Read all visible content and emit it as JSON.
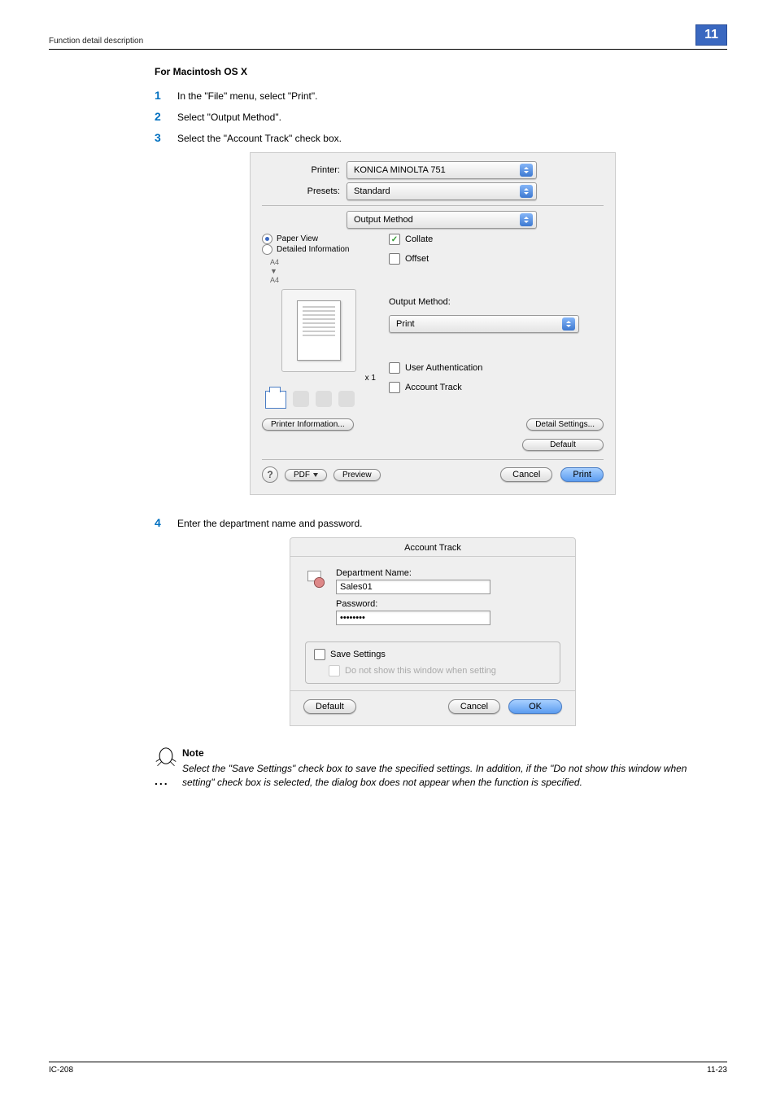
{
  "header": {
    "section_title": "Function detail description",
    "chapter_number": "11"
  },
  "heading": "For Macintosh OS X",
  "steps": {
    "s1": {
      "num": "1",
      "text": "In the \"File\" menu, select \"Print\"."
    },
    "s2": {
      "num": "2",
      "text": "Select \"Output Method\"."
    },
    "s3": {
      "num": "3",
      "text": "Select the \"Account Track\" check box."
    },
    "s4": {
      "num": "4",
      "text": "Enter the department name and password."
    }
  },
  "print_dialog": {
    "printer_label": "Printer:",
    "printer_value": "KONICA MINOLTA 751",
    "presets_label": "Presets:",
    "presets_value": "Standard",
    "panel_value": "Output Method",
    "paper_view_label": "Paper View",
    "detailed_info_label": "Detailed Information",
    "size_top": "A4",
    "size_arrow": "▼",
    "size_bottom": "A4",
    "x1": "x 1",
    "collate_label": "Collate",
    "offset_label": "Offset",
    "output_method_label": "Output Method:",
    "output_method_value": "Print",
    "user_auth_label": "User Authentication",
    "account_track_label": "Account Track",
    "printer_info_btn": "Printer Information...",
    "detail_settings_btn": "Detail Settings...",
    "default_btn": "Default",
    "pdf_btn": "PDF",
    "preview_btn": "Preview",
    "cancel_btn": "Cancel",
    "print_btn": "Print"
  },
  "account_dialog": {
    "title": "Account Track",
    "dept_label": "Department Name:",
    "dept_value": "Sales01",
    "pwd_label": "Password:",
    "pwd_value": "••••••••",
    "save_settings_label": "Save Settings",
    "donotshow_label": "Do not show this window when setting",
    "default_btn": "Default",
    "cancel_btn": "Cancel",
    "ok_btn": "OK"
  },
  "note": {
    "title": "Note",
    "body": "Select the \"Save Settings\" check box to save the specified settings. In addition, if the \"Do not show this window when setting\" check box is selected, the dialog box does not appear when the function is specified."
  },
  "footer": {
    "left": "IC-208",
    "right": "11-23"
  }
}
